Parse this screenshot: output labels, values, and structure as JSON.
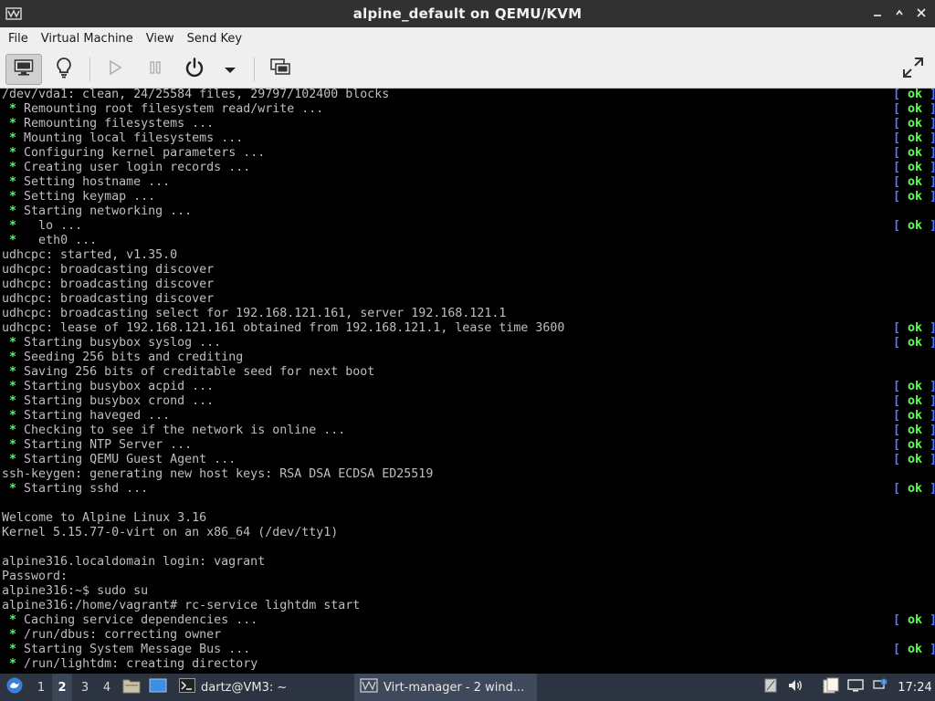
{
  "window": {
    "title": "alpine_default on QEMU/KVM",
    "app_icon": "virt-manager-icon",
    "controls": [
      "minimize-icon",
      "maximize-icon",
      "close-icon"
    ]
  },
  "menubar": {
    "file": "File",
    "virtual_machine": "Virtual Machine",
    "view": "View",
    "send_key": "Send Key"
  },
  "toolbar": {
    "buttons": [
      "console-view-icon",
      "details-lightbulb-icon",
      "run-play-icon",
      "pause-icon",
      "power-icon",
      "power-menu-chevron-icon",
      "screenshot-icon",
      "fullscreen-icon"
    ]
  },
  "console": {
    "lines": [
      {
        "text": "/dev/vda1: clean, 24/25584 files, 29797/102400 blocks",
        "star": false,
        "ok": true
      },
      {
        "text": "Remounting root filesystem read/write ...",
        "star": true,
        "ok": true
      },
      {
        "text": "Remounting filesystems ...",
        "star": true,
        "ok": true
      },
      {
        "text": "Mounting local filesystems ...",
        "star": true,
        "ok": true
      },
      {
        "text": "Configuring kernel parameters ...",
        "star": true,
        "ok": true
      },
      {
        "text": "Creating user login records ...",
        "star": true,
        "ok": true
      },
      {
        "text": "Setting hostname ...",
        "star": true,
        "ok": true
      },
      {
        "text": "Setting keymap ...",
        "star": true,
        "ok": true
      },
      {
        "text": "Starting networking ...",
        "star": true,
        "ok": false
      },
      {
        "text": "  lo ...",
        "star": true,
        "ok": true
      },
      {
        "text": "  eth0 ...",
        "star": true,
        "ok": false
      },
      {
        "text": "udhcpc: started, v1.35.0",
        "star": false,
        "ok": false
      },
      {
        "text": "udhcpc: broadcasting discover",
        "star": false,
        "ok": false
      },
      {
        "text": "udhcpc: broadcasting discover",
        "star": false,
        "ok": false
      },
      {
        "text": "udhcpc: broadcasting discover",
        "star": false,
        "ok": false
      },
      {
        "text": "udhcpc: broadcasting select for 192.168.121.161, server 192.168.121.1",
        "star": false,
        "ok": false
      },
      {
        "text": "udhcpc: lease of 192.168.121.161 obtained from 192.168.121.1, lease time 3600",
        "star": false,
        "ok": true
      },
      {
        "text": "Starting busybox syslog ...",
        "star": true,
        "ok": true
      },
      {
        "text": "Seeding 256 bits and crediting",
        "star": true,
        "ok": false
      },
      {
        "text": "Saving 256 bits of creditable seed for next boot",
        "star": true,
        "ok": false
      },
      {
        "text": "Starting busybox acpid ...",
        "star": true,
        "ok": true
      },
      {
        "text": "Starting busybox crond ...",
        "star": true,
        "ok": true
      },
      {
        "text": "Starting haveged ...",
        "star": true,
        "ok": true
      },
      {
        "text": "Checking to see if the network is online ...",
        "star": true,
        "ok": true
      },
      {
        "text": "Starting NTP Server ...",
        "star": true,
        "ok": true
      },
      {
        "text": "Starting QEMU Guest Agent ...",
        "star": true,
        "ok": true
      },
      {
        "text": "ssh-keygen: generating new host keys: RSA DSA ECDSA ED25519",
        "star": false,
        "ok": false
      },
      {
        "text": "Starting sshd ...",
        "star": true,
        "ok": true
      },
      {
        "text": "",
        "star": false,
        "ok": false
      },
      {
        "text": "Welcome to Alpine Linux 3.16",
        "star": false,
        "ok": false
      },
      {
        "text": "Kernel 5.15.77-0-virt on an x86_64 (/dev/tty1)",
        "star": false,
        "ok": false
      },
      {
        "text": "",
        "star": false,
        "ok": false
      },
      {
        "text": "alpine316.localdomain login: vagrant",
        "star": false,
        "ok": false
      },
      {
        "text": "Password:",
        "star": false,
        "ok": false
      },
      {
        "text": "alpine316:~$ sudo su",
        "star": false,
        "ok": false
      },
      {
        "text": "alpine316:/home/vagrant# rc-service lightdm start",
        "star": false,
        "ok": false
      },
      {
        "text": "Caching service dependencies ...",
        "star": true,
        "ok": true
      },
      {
        "text": "/run/dbus: correcting owner",
        "star": true,
        "ok": false
      },
      {
        "text": "Starting System Message Bus ...",
        "star": true,
        "ok": true
      },
      {
        "text": "/run/lightdm: creating directory",
        "star": true,
        "ok": false
      }
    ],
    "star_glyph": "*",
    "ok_open": "[ ",
    "ok_word": "ok",
    "ok_close": " ]"
  },
  "taskbar": {
    "menu_icon": "start-menu-icon",
    "workspaces": [
      "1",
      "2",
      "3",
      "4"
    ],
    "current_workspace": "2",
    "launchers": [
      "file-manager-icon",
      "desktop-icon"
    ],
    "tasks": [
      {
        "icon": "terminal-icon",
        "label": "dartz@VM3: ~"
      },
      {
        "icon": "virt-manager-icon",
        "label": "Virt-manager - 2 wind..."
      }
    ],
    "tray": [
      "clipboard-tray-icon",
      "volume-icon",
      "notes-tray-icon",
      "network-tray-icon"
    ],
    "clock": "17:24"
  }
}
